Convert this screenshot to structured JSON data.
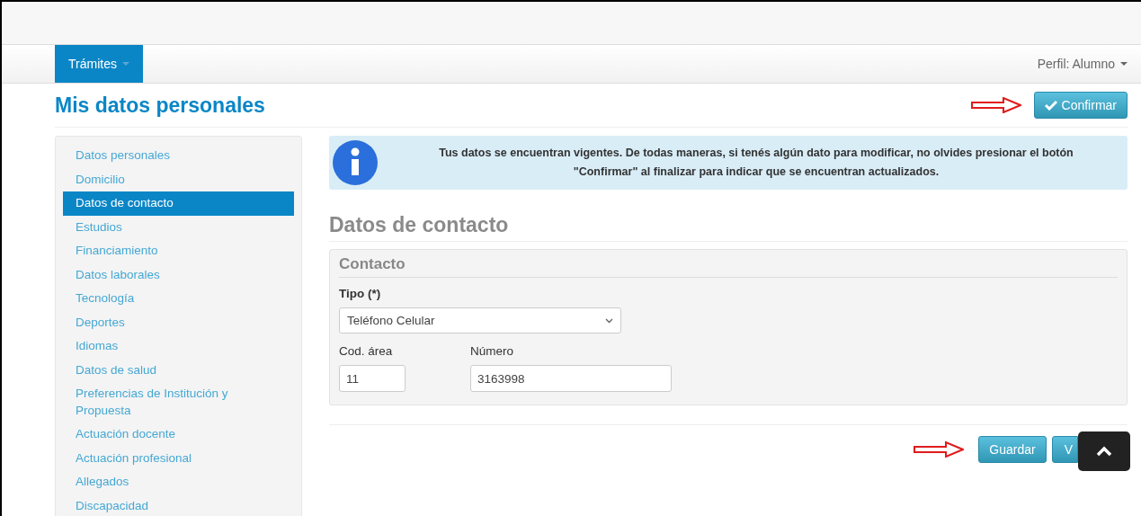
{
  "navbar": {
    "menu": {
      "label": "Trámites",
      "selected": true
    },
    "profile": "Perfil: Alumno"
  },
  "page_title": "Mis datos personales",
  "confirm_button": "Confirmar",
  "sidebar": {
    "items": [
      {
        "label": "Datos personales",
        "selected": false
      },
      {
        "label": "Domicilio",
        "selected": false
      },
      {
        "label": "Datos de contacto",
        "selected": true
      },
      {
        "label": "Estudios",
        "selected": false
      },
      {
        "label": "Financiamiento",
        "selected": false
      },
      {
        "label": "Datos laborales",
        "selected": false
      },
      {
        "label": "Tecnología",
        "selected": false
      },
      {
        "label": "Deportes",
        "selected": false
      },
      {
        "label": "Idiomas",
        "selected": false
      },
      {
        "label": "Datos de salud",
        "selected": false
      },
      {
        "label": "Preferencias de Institución y Propuesta",
        "selected": false
      },
      {
        "label": "Actuación docente",
        "selected": false
      },
      {
        "label": "Actuación profesional",
        "selected": false
      },
      {
        "label": "Allegados",
        "selected": false
      },
      {
        "label": "Discapacidad",
        "selected": false
      }
    ]
  },
  "alert": {
    "text": "Tus datos se encuentran vigentes. De todas maneras, si tenés algún dato para modificar, no olvides presionar el botón \"Confirmar\" al finalizar para indicar que se encuentran actualizados."
  },
  "section_title": "Datos de contacto",
  "form": {
    "legend": "Contacto",
    "tipo": {
      "label": "Tipo (*)",
      "value": "Teléfono Celular"
    },
    "area": {
      "label": "Cod. área",
      "value": "11"
    },
    "numero": {
      "label": "Número",
      "value": "3163998"
    }
  },
  "buttons": [
    "Guardar",
    "V"
  ]
}
